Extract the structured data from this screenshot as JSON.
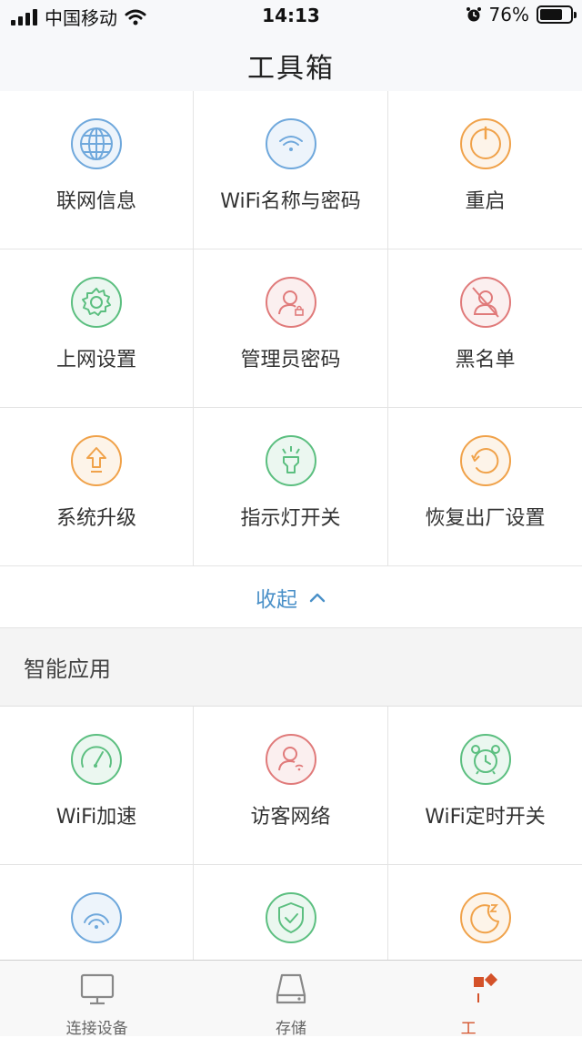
{
  "status_bar": {
    "carrier": "中国移动",
    "time": "14:13",
    "battery_text": "76%",
    "battery_level": 0.76
  },
  "nav": {
    "title": "工具箱"
  },
  "tools": [
    {
      "label": "联网信息",
      "icon": "globe-icon",
      "color": "#6fa8dc"
    },
    {
      "label": "WiFi名称与密码",
      "icon": "wifi-icon",
      "color": "#6fa8dc"
    },
    {
      "label": "重启",
      "icon": "power-icon",
      "color": "#f0a24a"
    },
    {
      "label": "上网设置",
      "icon": "gear-icon",
      "color": "#5cbf80"
    },
    {
      "label": "管理员密码",
      "icon": "admin-lock-icon",
      "color": "#e07a7a"
    },
    {
      "label": "黑名单",
      "icon": "blacklist-icon",
      "color": "#e07a7a"
    },
    {
      "label": "系统升级",
      "icon": "upgrade-arrow-icon",
      "color": "#f0a24a"
    },
    {
      "label": "指示灯开关",
      "icon": "indicator-light-icon",
      "color": "#5cbf80"
    },
    {
      "label": "恢复出厂设置",
      "icon": "factory-reset-icon",
      "color": "#f0a24a"
    }
  ],
  "collapse": {
    "label": "收起",
    "icon": "chevron-up-icon"
  },
  "smart_section": {
    "title": "智能应用"
  },
  "smart_apps": [
    {
      "label": "WiFi加速",
      "icon": "speedometer-icon",
      "color": "#5cbf80"
    },
    {
      "label": "访客网络",
      "icon": "guest-network-icon",
      "color": "#e07a7a"
    },
    {
      "label": "WiFi定时开关",
      "icon": "alarm-clock-icon",
      "color": "#5cbf80"
    },
    {
      "label": "",
      "icon": "wifi-signal-icon",
      "color": "#6fa8dc"
    },
    {
      "label": "",
      "icon": "security-shield-icon",
      "color": "#5cbf80"
    },
    {
      "label": "",
      "icon": "sleep-moon-icon",
      "color": "#f0a24a"
    }
  ],
  "tab_bar": {
    "tabs": [
      {
        "label": "连接设备",
        "icon": "monitor-icon"
      },
      {
        "label": "存储",
        "icon": "storage-icon"
      },
      {
        "label": "工",
        "icon": "toolbox-icon",
        "active": true
      }
    ]
  },
  "colors": {
    "accent_blue": "#4a90c8",
    "active_tab": "#d4522a"
  }
}
